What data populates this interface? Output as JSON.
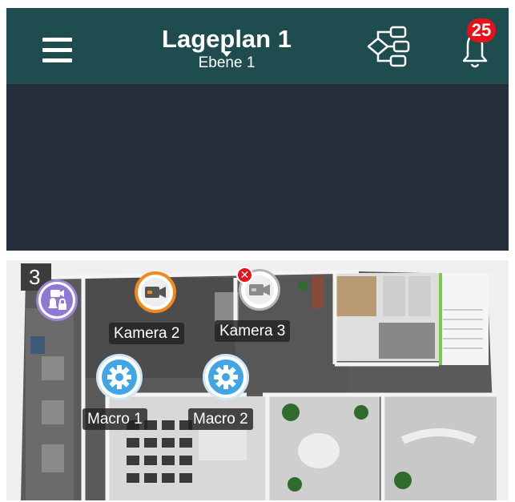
{
  "header": {
    "title": "Lageplan 1",
    "subtitle": "Ebene 1",
    "menu_icon": "hamburger-menu-icon",
    "tree_icon": "hierarchy-tree-icon",
    "bell_icon": "bell-icon",
    "notification_count": "25"
  },
  "colors": {
    "header_bg": "#1f4d4f",
    "dark_band": "#232e3a",
    "badge_red": "#e8101a",
    "camera_active_ring": "#f08a1c",
    "macro_blue": "#41a5e6",
    "lock_purple": "#8e7ad6"
  },
  "floorplan": {
    "level": "3",
    "markers": {
      "lock_camera": {
        "icon": "camera-lock-icon"
      },
      "kamera2": {
        "label": "Kamera 2",
        "icon": "video-camera-icon",
        "status": "active"
      },
      "kamera3": {
        "label": "Kamera 3",
        "icon": "video-camera-icon",
        "status": "error",
        "status_icon": "error-x-icon"
      },
      "macro1": {
        "label": "Macro 1",
        "icon": "gear-icon"
      },
      "macro2": {
        "label": "Macro 2",
        "icon": "gear-icon"
      }
    }
  }
}
